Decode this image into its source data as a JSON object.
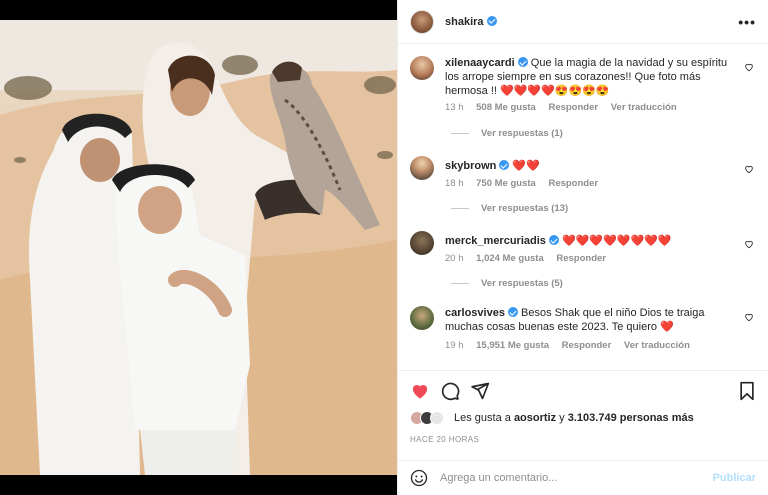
{
  "post": {
    "author": "shakira",
    "more_icon": "more-dots-icon",
    "image_alt": "photo-desert-family-falcon"
  },
  "comments": [
    {
      "user": "xilenaaycardi",
      "text": "Que la magia de la navidad y su espíritu los arrope siempre en sus corazones!! Que foto más hermosa !!",
      "emoji": "❤️❤️❤️❤️😍😍😍😍",
      "time": "13 h",
      "likes": "508 Me gusta",
      "reply": "Responder",
      "translate": "Ver traducción",
      "view_replies": "Ver respuestas (1)"
    },
    {
      "user": "skybrown",
      "text": "",
      "emoji": "❤️❤️",
      "time": "18 h",
      "likes": "750 Me gusta",
      "reply": "Responder",
      "view_replies": "Ver respuestas (13)"
    },
    {
      "user": "merck_mercuriadis",
      "text": "",
      "emoji": "❤️❤️❤️❤️❤️❤️❤️❤️",
      "time": "20 h",
      "likes": "1,024 Me gusta",
      "reply": "Responder",
      "view_replies": "Ver respuestas (5)"
    },
    {
      "user": "carlosvives",
      "text": "Besos Shak que el niño Dios te traiga muchas cosas buenas este 2023. Te quiero",
      "emoji": "❤️",
      "time": "19 h",
      "likes": "15,951 Me gusta",
      "reply": "Responder",
      "translate": "Ver traducción"
    }
  ],
  "actions": {
    "liked": true,
    "like_color": "#ed4956",
    "likes_prefix": "Les gusta a ",
    "likes_user": "aosortiz",
    "likes_middle": " y ",
    "likes_count": "3.103.749 personas más",
    "timestamp": "HACE 20 HORAS"
  },
  "composer": {
    "placeholder": "Agrega un comentario...",
    "publish": "Publicar",
    "emoji_icon": "smiley-icon"
  },
  "colors": {
    "verified": "#3897f0",
    "muted": "#8e8e8e",
    "publish_disabled": "#b2dffc"
  }
}
